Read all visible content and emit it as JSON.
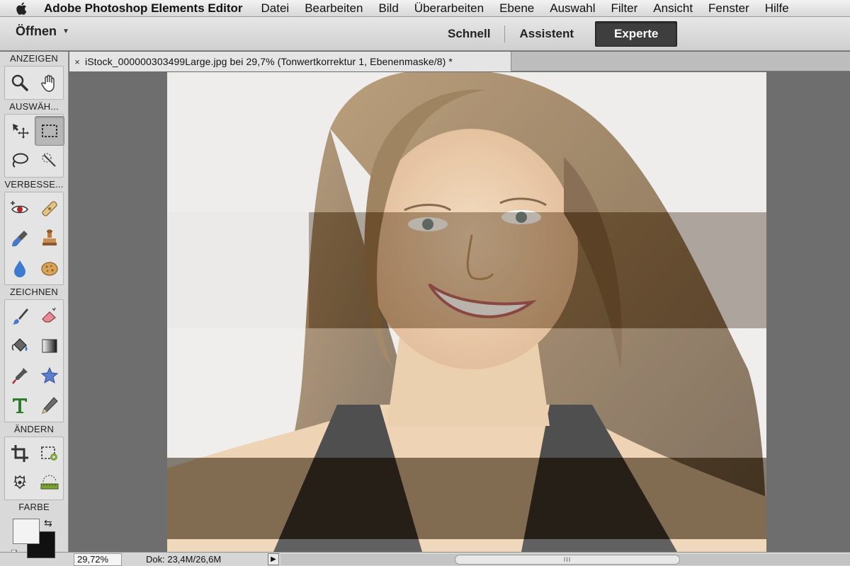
{
  "menubar": {
    "app_name": "Adobe Photoshop Elements Editor",
    "items": [
      "Datei",
      "Bearbeiten",
      "Bild",
      "Überarbeiten",
      "Ebene",
      "Auswahl",
      "Filter",
      "Ansicht",
      "Fenster",
      "Hilfe"
    ]
  },
  "appbar": {
    "open_label": "Öffnen",
    "modes": {
      "quick": "Schnell",
      "guided": "Assistent",
      "expert": "Experte",
      "active": "Experte"
    }
  },
  "toolpanel": {
    "sections": {
      "view": "ANZEIGEN",
      "select": "AUSWÄH...",
      "enhance": "VERBESSE...",
      "draw": "ZEICHNEN",
      "modify": "ÄNDERN",
      "color": "FARBE"
    },
    "tools": {
      "zoom": "zoom-icon",
      "hand": "hand-icon",
      "move": "move-icon",
      "marquee": "rect-marquee-icon",
      "lasso": "lasso-icon",
      "quick_select": "quick-select-icon",
      "red_eye": "red-eye-icon",
      "spot_heal": "spot-heal-icon",
      "smart_brush": "smart-brush-icon",
      "clone": "clone-stamp-icon",
      "blur": "blur-icon",
      "sponge": "sponge-icon",
      "brush": "brush-icon",
      "eraser": "eraser-icon",
      "paint_bucket": "paint-bucket-icon",
      "gradient": "gradient-icon",
      "eyedropper": "eyedropper-icon",
      "custom_shape": "custom-shape-icon",
      "type": "type-icon",
      "pencil": "pencil-icon",
      "crop": "crop-icon",
      "recompose": "recompose-icon",
      "content_move": "content-move-icon",
      "straighten": "straighten-icon"
    },
    "colors": {
      "foreground": "#f3f3f3",
      "background": "#111111"
    }
  },
  "document": {
    "tab_title": "iStock_000000303499Large.jpg bei 29,7% (Tonwertkorrektur 1, Ebenenmaske/8) *",
    "close_label": "×"
  },
  "statusbar": {
    "zoom": "29,72%",
    "doc_size": "Dok: 23,4M/26,6M",
    "scroll_grip": "III"
  },
  "colors": {
    "accent_active_mode": "#3e3e3e",
    "canvas_bg": "#6e6e6e"
  }
}
